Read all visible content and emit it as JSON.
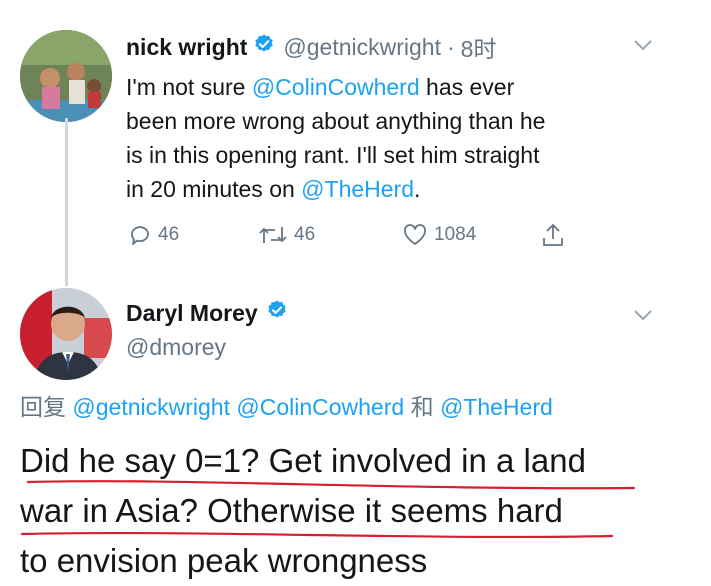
{
  "tweet1": {
    "author_name": "nick wright",
    "handle": "@getnickwright",
    "separator": "·",
    "time": "8时",
    "text_lines": [
      {
        "plain": "I'm not sure ",
        "mention": "@ColinCowherd",
        "tail": " has ever"
      },
      {
        "plain": "been more wrong about anything than he"
      },
      {
        "plain": "is in this opening rant. I'll set him straight"
      },
      {
        "plain": "in 20 minutes on ",
        "mention": "@TheHerd",
        "tail": "."
      }
    ],
    "actions": {
      "replies": "46",
      "retweets": "46",
      "likes": "1084"
    }
  },
  "tweet2": {
    "author_name": "Daryl Morey",
    "handle": "@dmorey",
    "reply_label": "回复",
    "reply_to_1": "@getnickwright",
    "reply_to_2": "@ColinCowherd",
    "reply_conj": "和",
    "reply_to_3": "@TheHerd",
    "text_lines": [
      "Did he say 0=1? Get involved in a land",
      "war in Asia? Otherwise it seems hard",
      "to envision peak wrongness"
    ]
  },
  "colors": {
    "link": "#1da1f2",
    "text": "#14171a",
    "muted": "#657786",
    "underline": "#d81e2c"
  }
}
